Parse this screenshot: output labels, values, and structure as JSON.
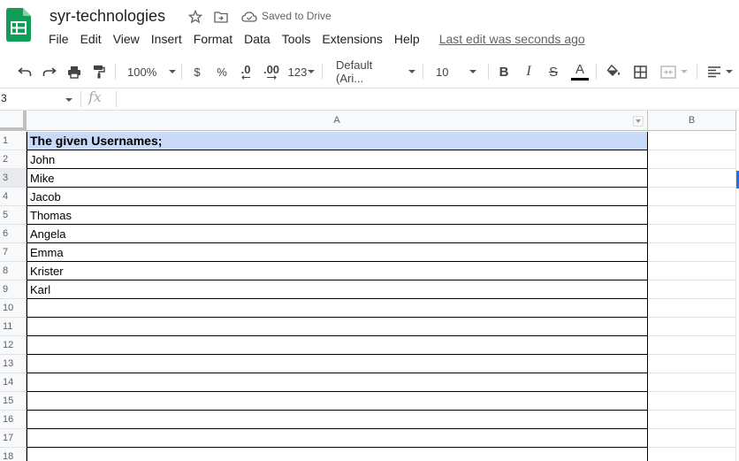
{
  "header": {
    "doc_title": "syr-technologies",
    "saved_status": "Saved to Drive",
    "menu": [
      "File",
      "Edit",
      "View",
      "Insert",
      "Format",
      "Data",
      "Tools",
      "Extensions",
      "Help"
    ],
    "last_edit": "Last edit was seconds ago"
  },
  "toolbar": {
    "zoom": "100%",
    "currency": "$",
    "percent": "%",
    "decrease_decimal": ".0",
    "increase_decimal": ".00",
    "more_formats": "123",
    "font": "Default (Ari...",
    "font_size": "10",
    "bold": "B",
    "italic": "I",
    "strike": "S",
    "text_color_label": "A"
  },
  "formula_bar": {
    "name_box": "3",
    "fx": "fx",
    "value": ""
  },
  "grid": {
    "columns": [
      "A",
      "B"
    ],
    "rows": [
      {
        "num": "1",
        "a": "The given Usernames;"
      },
      {
        "num": "2",
        "a": "John"
      },
      {
        "num": "3",
        "a": "Mike"
      },
      {
        "num": "4",
        "a": "Jacob"
      },
      {
        "num": "5",
        "a": "Thomas"
      },
      {
        "num": "6",
        "a": "Angela"
      },
      {
        "num": "7",
        "a": "Emma"
      },
      {
        "num": "8",
        "a": "Krister"
      },
      {
        "num": "9",
        "a": "Karl"
      },
      {
        "num": "10",
        "a": ""
      },
      {
        "num": "11",
        "a": ""
      },
      {
        "num": "12",
        "a": ""
      },
      {
        "num": "13",
        "a": ""
      },
      {
        "num": "14",
        "a": ""
      },
      {
        "num": "15",
        "a": ""
      },
      {
        "num": "16",
        "a": ""
      },
      {
        "num": "17",
        "a": ""
      },
      {
        "num": "18",
        "a": ""
      }
    ],
    "header_fill_color": "#c9daf8",
    "active_row": "3"
  },
  "colors": {
    "sheets_green": "#0f9d58",
    "selection_blue": "#1a73e8"
  }
}
